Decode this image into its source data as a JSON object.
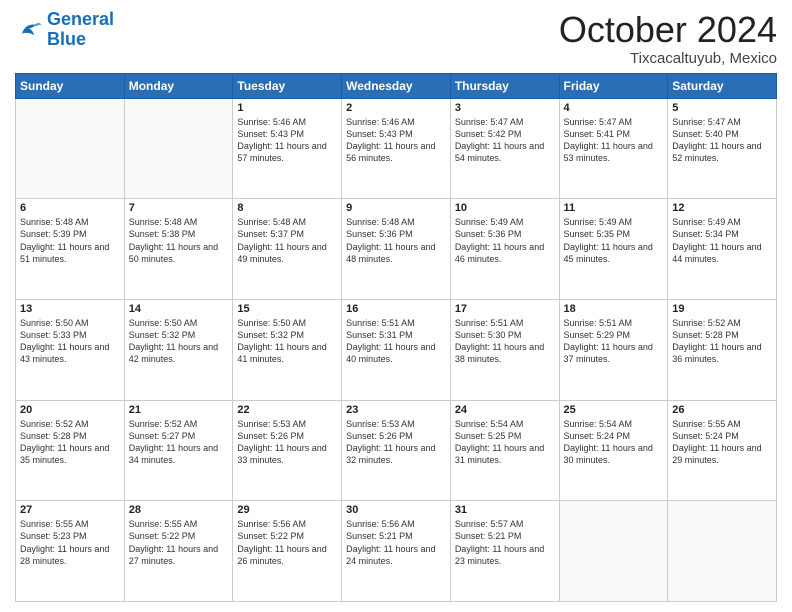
{
  "logo": {
    "line1": "General",
    "line2": "Blue"
  },
  "title": "October 2024",
  "location": "Tixcacaltuyub, Mexico",
  "days_of_week": [
    "Sunday",
    "Monday",
    "Tuesday",
    "Wednesday",
    "Thursday",
    "Friday",
    "Saturday"
  ],
  "weeks": [
    [
      {
        "day": "",
        "sunrise": "",
        "sunset": "",
        "daylight": ""
      },
      {
        "day": "",
        "sunrise": "",
        "sunset": "",
        "daylight": ""
      },
      {
        "day": "1",
        "sunrise": "Sunrise: 5:46 AM",
        "sunset": "Sunset: 5:43 PM",
        "daylight": "Daylight: 11 hours and 57 minutes."
      },
      {
        "day": "2",
        "sunrise": "Sunrise: 5:46 AM",
        "sunset": "Sunset: 5:43 PM",
        "daylight": "Daylight: 11 hours and 56 minutes."
      },
      {
        "day": "3",
        "sunrise": "Sunrise: 5:47 AM",
        "sunset": "Sunset: 5:42 PM",
        "daylight": "Daylight: 11 hours and 54 minutes."
      },
      {
        "day": "4",
        "sunrise": "Sunrise: 5:47 AM",
        "sunset": "Sunset: 5:41 PM",
        "daylight": "Daylight: 11 hours and 53 minutes."
      },
      {
        "day": "5",
        "sunrise": "Sunrise: 5:47 AM",
        "sunset": "Sunset: 5:40 PM",
        "daylight": "Daylight: 11 hours and 52 minutes."
      }
    ],
    [
      {
        "day": "6",
        "sunrise": "Sunrise: 5:48 AM",
        "sunset": "Sunset: 5:39 PM",
        "daylight": "Daylight: 11 hours and 51 minutes."
      },
      {
        "day": "7",
        "sunrise": "Sunrise: 5:48 AM",
        "sunset": "Sunset: 5:38 PM",
        "daylight": "Daylight: 11 hours and 50 minutes."
      },
      {
        "day": "8",
        "sunrise": "Sunrise: 5:48 AM",
        "sunset": "Sunset: 5:37 PM",
        "daylight": "Daylight: 11 hours and 49 minutes."
      },
      {
        "day": "9",
        "sunrise": "Sunrise: 5:48 AM",
        "sunset": "Sunset: 5:36 PM",
        "daylight": "Daylight: 11 hours and 48 minutes."
      },
      {
        "day": "10",
        "sunrise": "Sunrise: 5:49 AM",
        "sunset": "Sunset: 5:36 PM",
        "daylight": "Daylight: 11 hours and 46 minutes."
      },
      {
        "day": "11",
        "sunrise": "Sunrise: 5:49 AM",
        "sunset": "Sunset: 5:35 PM",
        "daylight": "Daylight: 11 hours and 45 minutes."
      },
      {
        "day": "12",
        "sunrise": "Sunrise: 5:49 AM",
        "sunset": "Sunset: 5:34 PM",
        "daylight": "Daylight: 11 hours and 44 minutes."
      }
    ],
    [
      {
        "day": "13",
        "sunrise": "Sunrise: 5:50 AM",
        "sunset": "Sunset: 5:33 PM",
        "daylight": "Daylight: 11 hours and 43 minutes."
      },
      {
        "day": "14",
        "sunrise": "Sunrise: 5:50 AM",
        "sunset": "Sunset: 5:32 PM",
        "daylight": "Daylight: 11 hours and 42 minutes."
      },
      {
        "day": "15",
        "sunrise": "Sunrise: 5:50 AM",
        "sunset": "Sunset: 5:32 PM",
        "daylight": "Daylight: 11 hours and 41 minutes."
      },
      {
        "day": "16",
        "sunrise": "Sunrise: 5:51 AM",
        "sunset": "Sunset: 5:31 PM",
        "daylight": "Daylight: 11 hours and 40 minutes."
      },
      {
        "day": "17",
        "sunrise": "Sunrise: 5:51 AM",
        "sunset": "Sunset: 5:30 PM",
        "daylight": "Daylight: 11 hours and 38 minutes."
      },
      {
        "day": "18",
        "sunrise": "Sunrise: 5:51 AM",
        "sunset": "Sunset: 5:29 PM",
        "daylight": "Daylight: 11 hours and 37 minutes."
      },
      {
        "day": "19",
        "sunrise": "Sunrise: 5:52 AM",
        "sunset": "Sunset: 5:28 PM",
        "daylight": "Daylight: 11 hours and 36 minutes."
      }
    ],
    [
      {
        "day": "20",
        "sunrise": "Sunrise: 5:52 AM",
        "sunset": "Sunset: 5:28 PM",
        "daylight": "Daylight: 11 hours and 35 minutes."
      },
      {
        "day": "21",
        "sunrise": "Sunrise: 5:52 AM",
        "sunset": "Sunset: 5:27 PM",
        "daylight": "Daylight: 11 hours and 34 minutes."
      },
      {
        "day": "22",
        "sunrise": "Sunrise: 5:53 AM",
        "sunset": "Sunset: 5:26 PM",
        "daylight": "Daylight: 11 hours and 33 minutes."
      },
      {
        "day": "23",
        "sunrise": "Sunrise: 5:53 AM",
        "sunset": "Sunset: 5:26 PM",
        "daylight": "Daylight: 11 hours and 32 minutes."
      },
      {
        "day": "24",
        "sunrise": "Sunrise: 5:54 AM",
        "sunset": "Sunset: 5:25 PM",
        "daylight": "Daylight: 11 hours and 31 minutes."
      },
      {
        "day": "25",
        "sunrise": "Sunrise: 5:54 AM",
        "sunset": "Sunset: 5:24 PM",
        "daylight": "Daylight: 11 hours and 30 minutes."
      },
      {
        "day": "26",
        "sunrise": "Sunrise: 5:55 AM",
        "sunset": "Sunset: 5:24 PM",
        "daylight": "Daylight: 11 hours and 29 minutes."
      }
    ],
    [
      {
        "day": "27",
        "sunrise": "Sunrise: 5:55 AM",
        "sunset": "Sunset: 5:23 PM",
        "daylight": "Daylight: 11 hours and 28 minutes."
      },
      {
        "day": "28",
        "sunrise": "Sunrise: 5:55 AM",
        "sunset": "Sunset: 5:22 PM",
        "daylight": "Daylight: 11 hours and 27 minutes."
      },
      {
        "day": "29",
        "sunrise": "Sunrise: 5:56 AM",
        "sunset": "Sunset: 5:22 PM",
        "daylight": "Daylight: 11 hours and 26 minutes."
      },
      {
        "day": "30",
        "sunrise": "Sunrise: 5:56 AM",
        "sunset": "Sunset: 5:21 PM",
        "daylight": "Daylight: 11 hours and 24 minutes."
      },
      {
        "day": "31",
        "sunrise": "Sunrise: 5:57 AM",
        "sunset": "Sunset: 5:21 PM",
        "daylight": "Daylight: 11 hours and 23 minutes."
      },
      {
        "day": "",
        "sunrise": "",
        "sunset": "",
        "daylight": ""
      },
      {
        "day": "",
        "sunrise": "",
        "sunset": "",
        "daylight": ""
      }
    ]
  ]
}
